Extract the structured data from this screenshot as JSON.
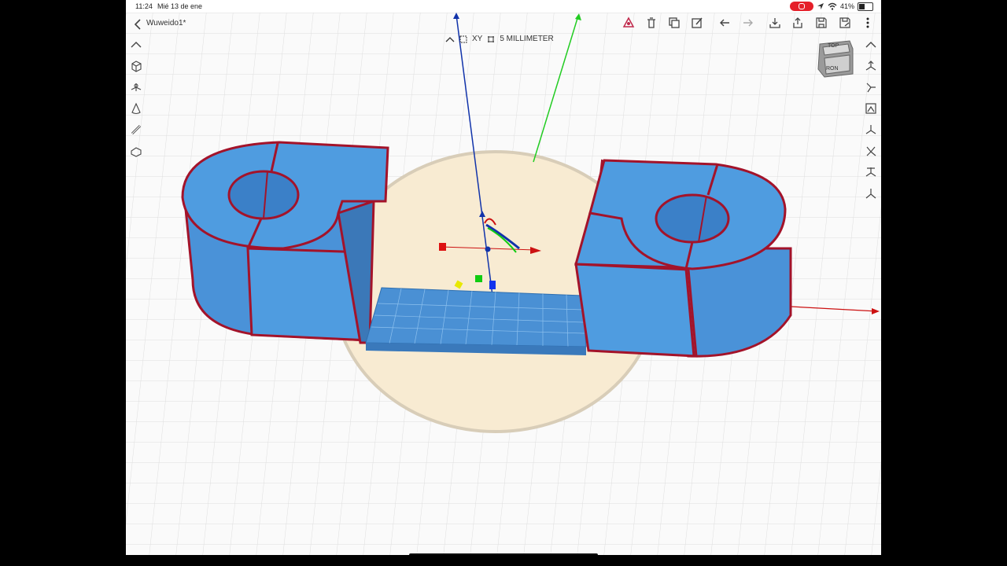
{
  "status": {
    "time": "11:24",
    "date": "Mié 13 de ene",
    "battery": "41%",
    "battery_level": 0.41
  },
  "document": {
    "title": "Wuweido1*"
  },
  "grid": {
    "plane": "XY",
    "snap": "5 MILLIMETER"
  },
  "viewcube": {
    "top": "TOP",
    "front": "RON"
  },
  "colors": {
    "model": "#4f9ce0",
    "edge": "#a3132a",
    "plate": "#f8ebd2",
    "grid": "#dcdcdc",
    "axis_x": "#cc1111",
    "axis_y": "#22cc22",
    "axis_z": "#1133aa"
  },
  "top_toolbar": [
    "triad-icon",
    "trash-icon",
    "duplicate-icon",
    "edit-icon",
    "undo-icon",
    "redo-icon",
    "import-icon",
    "export-icon",
    "save-icon",
    "save-as-icon",
    "more-icon"
  ],
  "left_toolbar": [
    "collapse-up-icon",
    "box-primitive-icon",
    "sketch-icon",
    "cone-icon",
    "pipe-icon",
    "modify-icon"
  ],
  "right_toolbar": [
    "collapse-up-icon",
    "view-iso-icon",
    "view-front-icon",
    "view-top-icon",
    "view-right-icon",
    "view-left-icon",
    "view-bottom-icon",
    "view-back-icon"
  ]
}
